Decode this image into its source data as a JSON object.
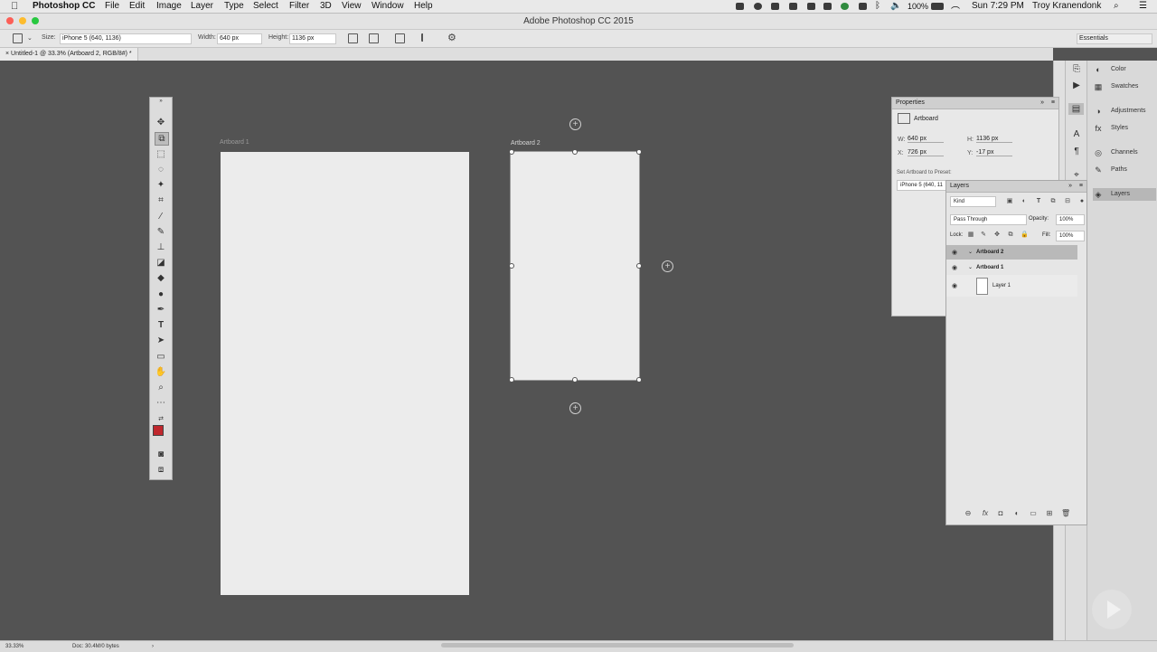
{
  "menubar": {
    "apple": "",
    "app": "Photoshop CC",
    "items": [
      "File",
      "Edit",
      "Image",
      "Layer",
      "Type",
      "Select",
      "Filter",
      "3D",
      "View",
      "Window",
      "Help"
    ],
    "battery": "100%",
    "clock": "Sun 7:29 PM",
    "user": "Troy Kranendonk"
  },
  "window": {
    "title": "Adobe Photoshop CC 2015"
  },
  "options": {
    "size_label": "Size:",
    "size_value": "iPhone 5 (640, 1136)",
    "width_label": "Width:",
    "width_value": "640 px",
    "height_label": "Height:",
    "height_value": "1136 px",
    "workspace": "Essentials"
  },
  "document": {
    "tab": "Untitled-1 @ 33.3% (Artboard 2, RGB/8#) *"
  },
  "canvas": {
    "artboard1_label": "Artboard 1",
    "artboard2_label": "Artboard 2",
    "plus": "+"
  },
  "status": {
    "zoom": "33.33%",
    "doc": "Doc: 30.4M/0 bytes",
    "arrow": "›"
  },
  "panel_dock": {
    "items": [
      {
        "icon": "color-icon",
        "glyph": "◐",
        "label": "Color"
      },
      {
        "icon": "swatches-icon",
        "glyph": "▦",
        "label": "Swatches"
      },
      {
        "icon": "adjustments-icon",
        "glyph": "◑",
        "label": "Adjustments"
      },
      {
        "icon": "styles-icon",
        "glyph": "fx",
        "label": "Styles"
      },
      {
        "icon": "channels-icon",
        "glyph": "◎",
        "label": "Channels"
      },
      {
        "icon": "paths-icon",
        "glyph": "✎",
        "label": "Paths"
      },
      {
        "icon": "layers-icon",
        "glyph": "◈",
        "label": "Layers"
      }
    ]
  },
  "properties": {
    "title": "Properties",
    "type": "Artboard",
    "w_label": "W:",
    "w_value": "640 px",
    "h_label": "H:",
    "h_value": "1136 px",
    "x_label": "X:",
    "x_value": "726 px",
    "y_label": "Y:",
    "y_value": "-17 px",
    "preset_label": "Set Artboard to Preset:",
    "preset_value": "iPhone 5 (640, 11"
  },
  "layers": {
    "title": "Layers",
    "kind": "Kind",
    "blend": "Pass Through",
    "opacity_label": "Opacity:",
    "opacity_value": "100%",
    "lock_label": "Lock:",
    "fill_label": "Fill:",
    "fill_value": "100%",
    "rows": [
      {
        "name": "Artboard 2"
      },
      {
        "name": "Artboard 1"
      },
      {
        "name": "Layer 1"
      }
    ],
    "eye": "👁",
    "disclosure": "⌄",
    "fx": "fx",
    "link": "⊖"
  },
  "colors": {
    "foreground": "#c0272d",
    "background": "#ffffff",
    "selected_row": "#b9b9b9"
  }
}
